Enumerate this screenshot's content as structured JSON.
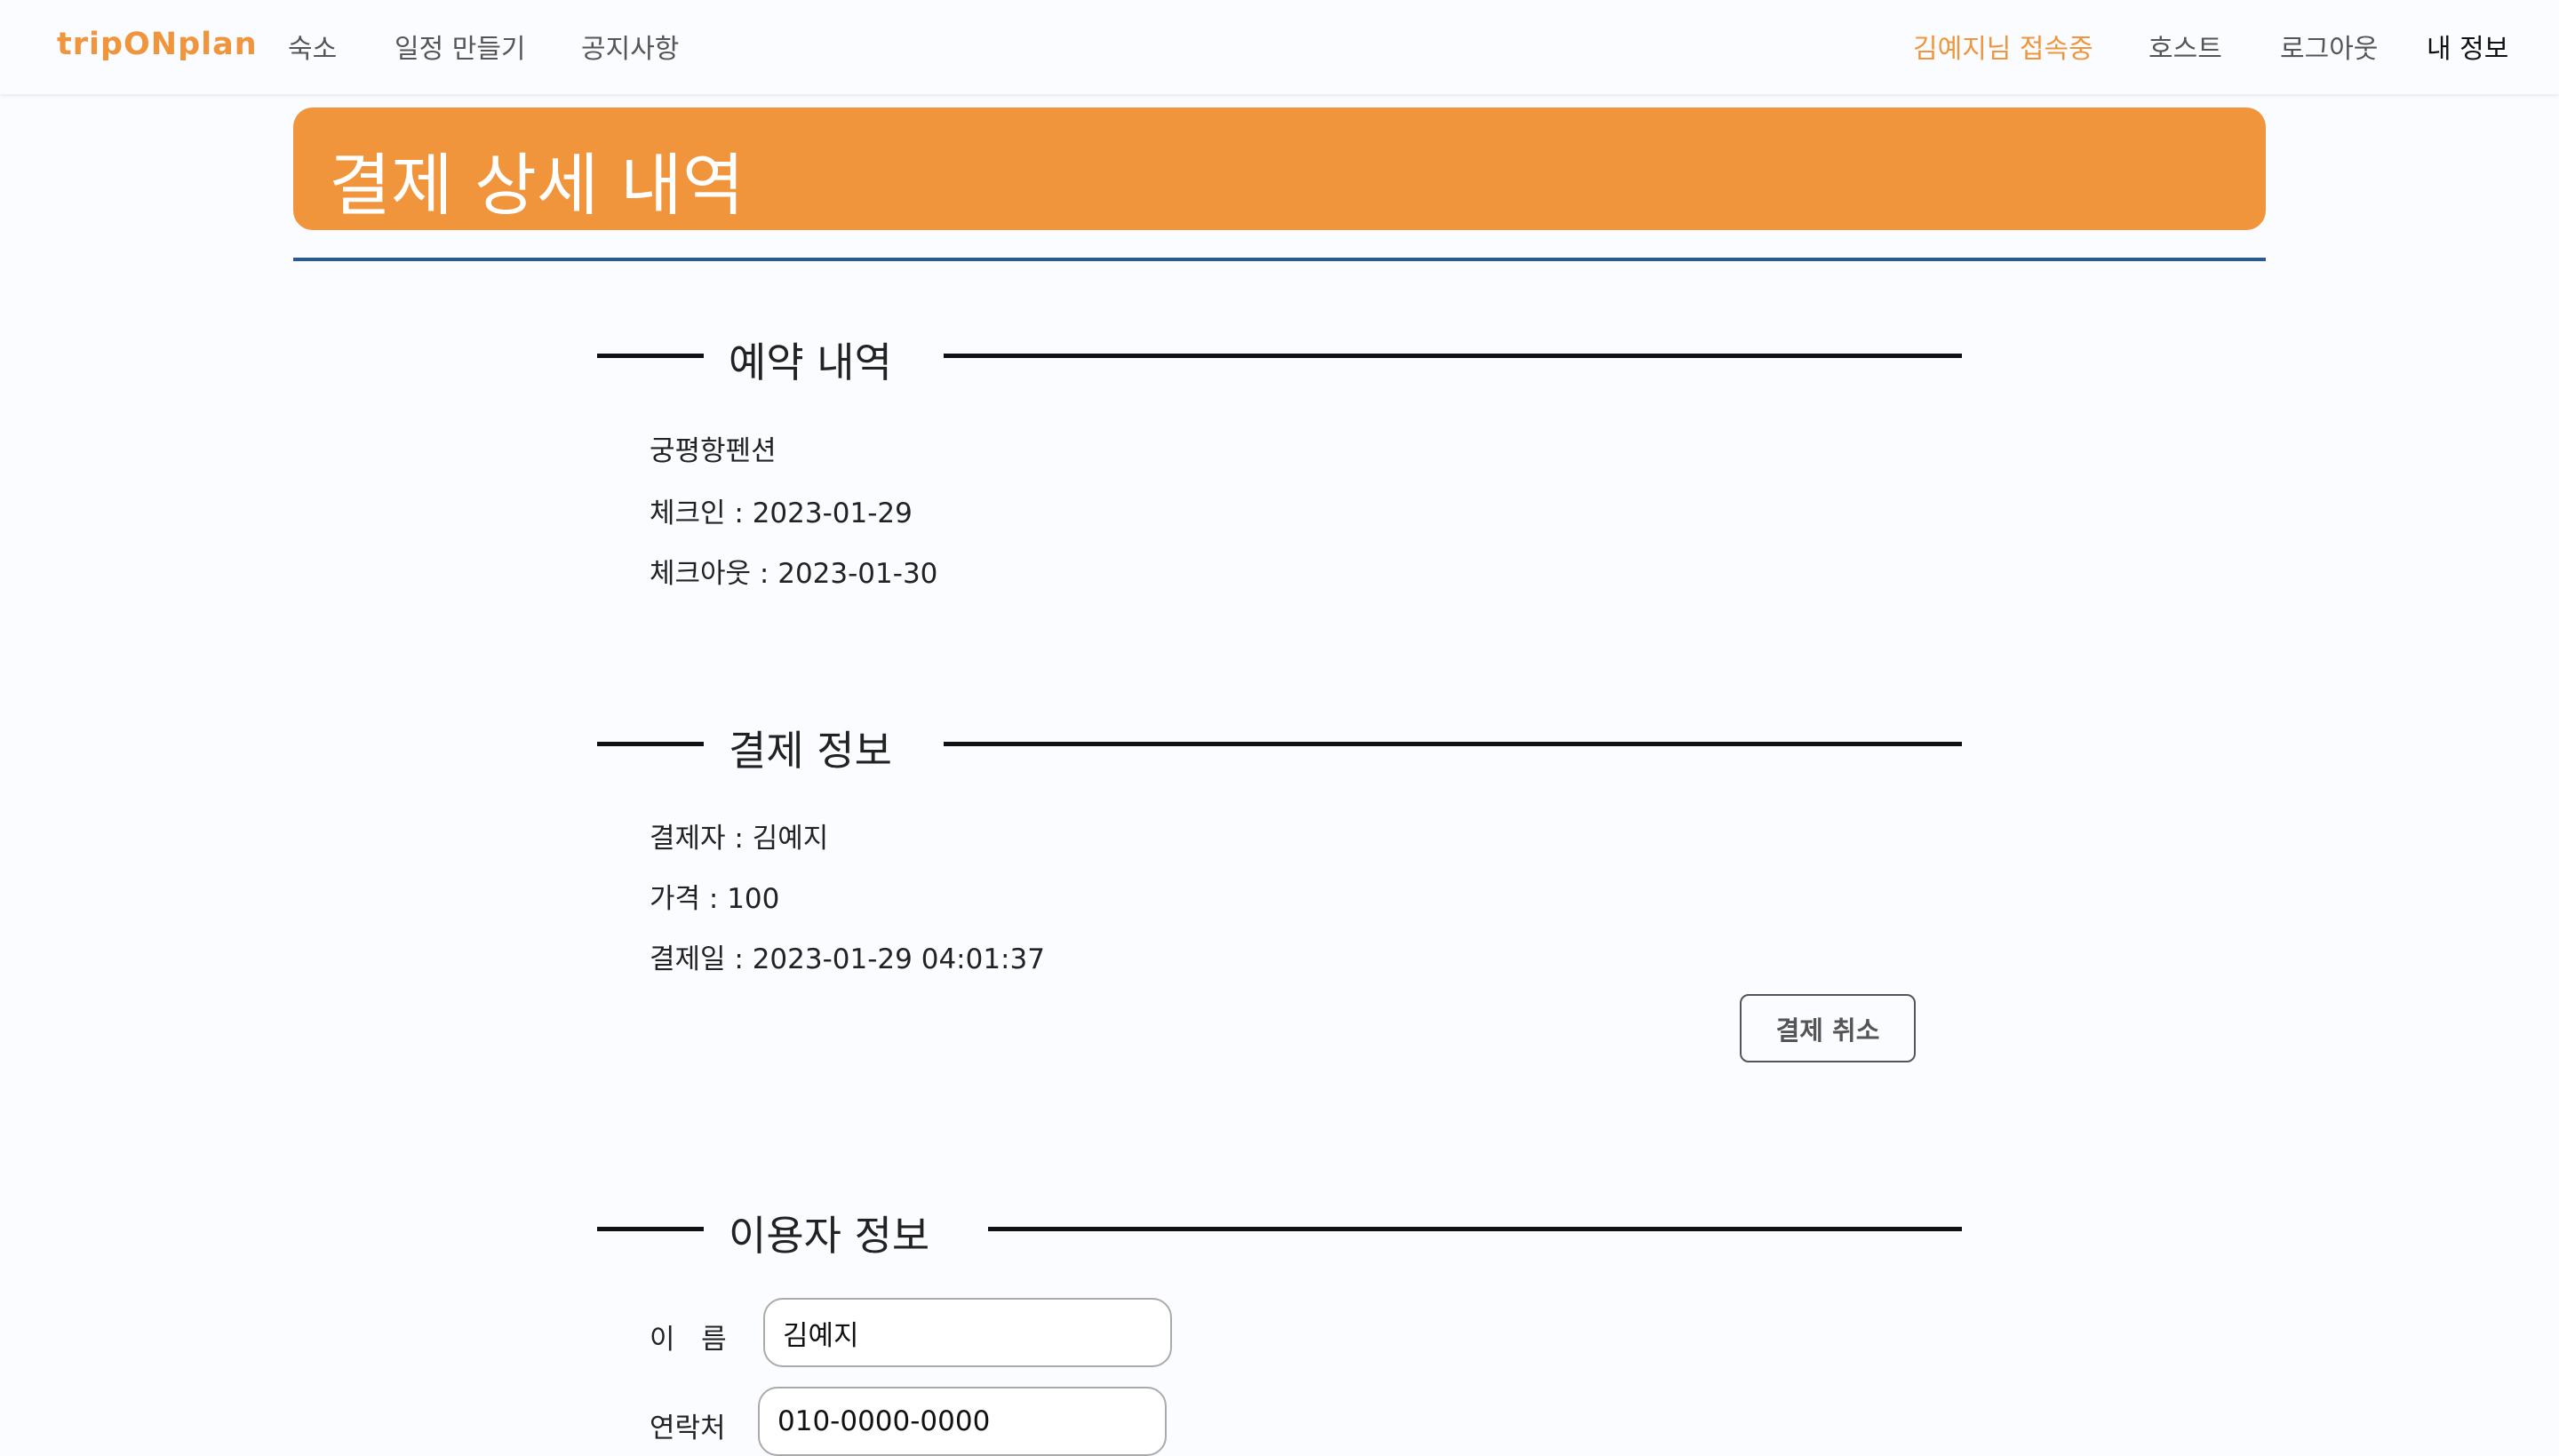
{
  "header": {
    "brand": "tripONplan",
    "nav_left": [
      "숙소",
      "일정 만들기",
      "공지사항"
    ],
    "user_status": "김예지님 접속중",
    "nav_right": [
      "호스트",
      "로그아웃",
      "내 정보"
    ]
  },
  "page": {
    "title": "결제 상세 내역"
  },
  "reservation": {
    "heading": "예약 내역",
    "property_name": "궁평항펜션",
    "checkin": "체크인 : 2023-01-29",
    "checkout": "체크아웃 : 2023-01-30"
  },
  "payment": {
    "heading": "결제 정보",
    "payer": "결제자 : 김예지",
    "price": "가격 : 100",
    "paid_at": "결제일 : 2023-01-29 04:01:37",
    "cancel_label": "결제 취소"
  },
  "user_info": {
    "heading": "이용자 정보",
    "name_label": "이   름",
    "name_value": "김예지",
    "phone_label": "연락처",
    "phone_value": "010-0000-0000"
  },
  "colors": {
    "accent": "#f0953c",
    "rule": "#2c5a8c",
    "background": "#fbfcff"
  }
}
